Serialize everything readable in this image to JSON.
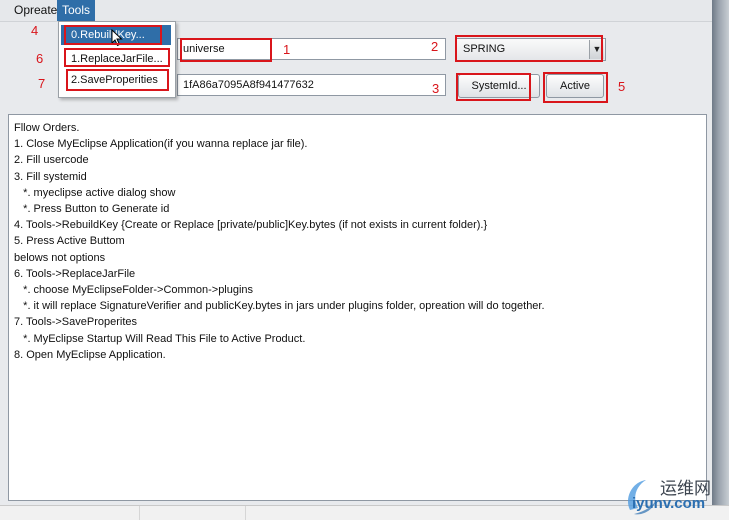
{
  "menubar": {
    "items": [
      {
        "label": "Opreate"
      },
      {
        "label": "Tools"
      }
    ]
  },
  "tools_menu": {
    "items": [
      {
        "label": "0.RebuildKey..."
      },
      {
        "label": "1.ReplaceJarFile..."
      },
      {
        "label": "2.SaveProperities"
      }
    ]
  },
  "form": {
    "usercode_value": "universe",
    "product_selected": "SPRING",
    "systemid_value": "1fA86a7095A8f941477632",
    "systemid_button": "SystemId...",
    "active_button": "Active"
  },
  "annotations": {
    "n1": "1",
    "n2": "2",
    "n3": "3",
    "n4": "4",
    "n5": "5",
    "n6": "6",
    "n7": "7"
  },
  "instructions": {
    "lines": [
      "Fllow Orders.",
      "1. Close MyEclipse Application(if you wanna replace jar file).",
      "2. Fill usercode",
      "3. Fill systemid",
      "   *. myeclipse active dialog show",
      "   *. Press Button to Generate id",
      "4. Tools->RebuildKey {Create or Replace [private/public]Key.bytes (if not exists in current folder).}",
      "5. Press Active Buttom",
      "belows not options",
      "6. Tools->ReplaceJarFile",
      "   *. choose MyEclipseFolder->Common->plugins",
      "   *. it will replace SignatureVerifier and publicKey.bytes in jars under plugins folder, opreation will do together.",
      "7. Tools->SaveProperites",
      "   *. MyEclipse Startup Will Read This File to Active Product.",
      "8. Open MyEclipse Application."
    ]
  },
  "watermark": {
    "cn": "运维网",
    "url": "iyunv.com"
  },
  "colors": {
    "annotation_red": "#d9151b",
    "menu_highlight": "#2f6ea8"
  },
  "icons": {
    "dropdown": "chevron-down-icon",
    "cursor": "mouse-pointer-icon",
    "watermark": "swirl-logo-icon"
  }
}
